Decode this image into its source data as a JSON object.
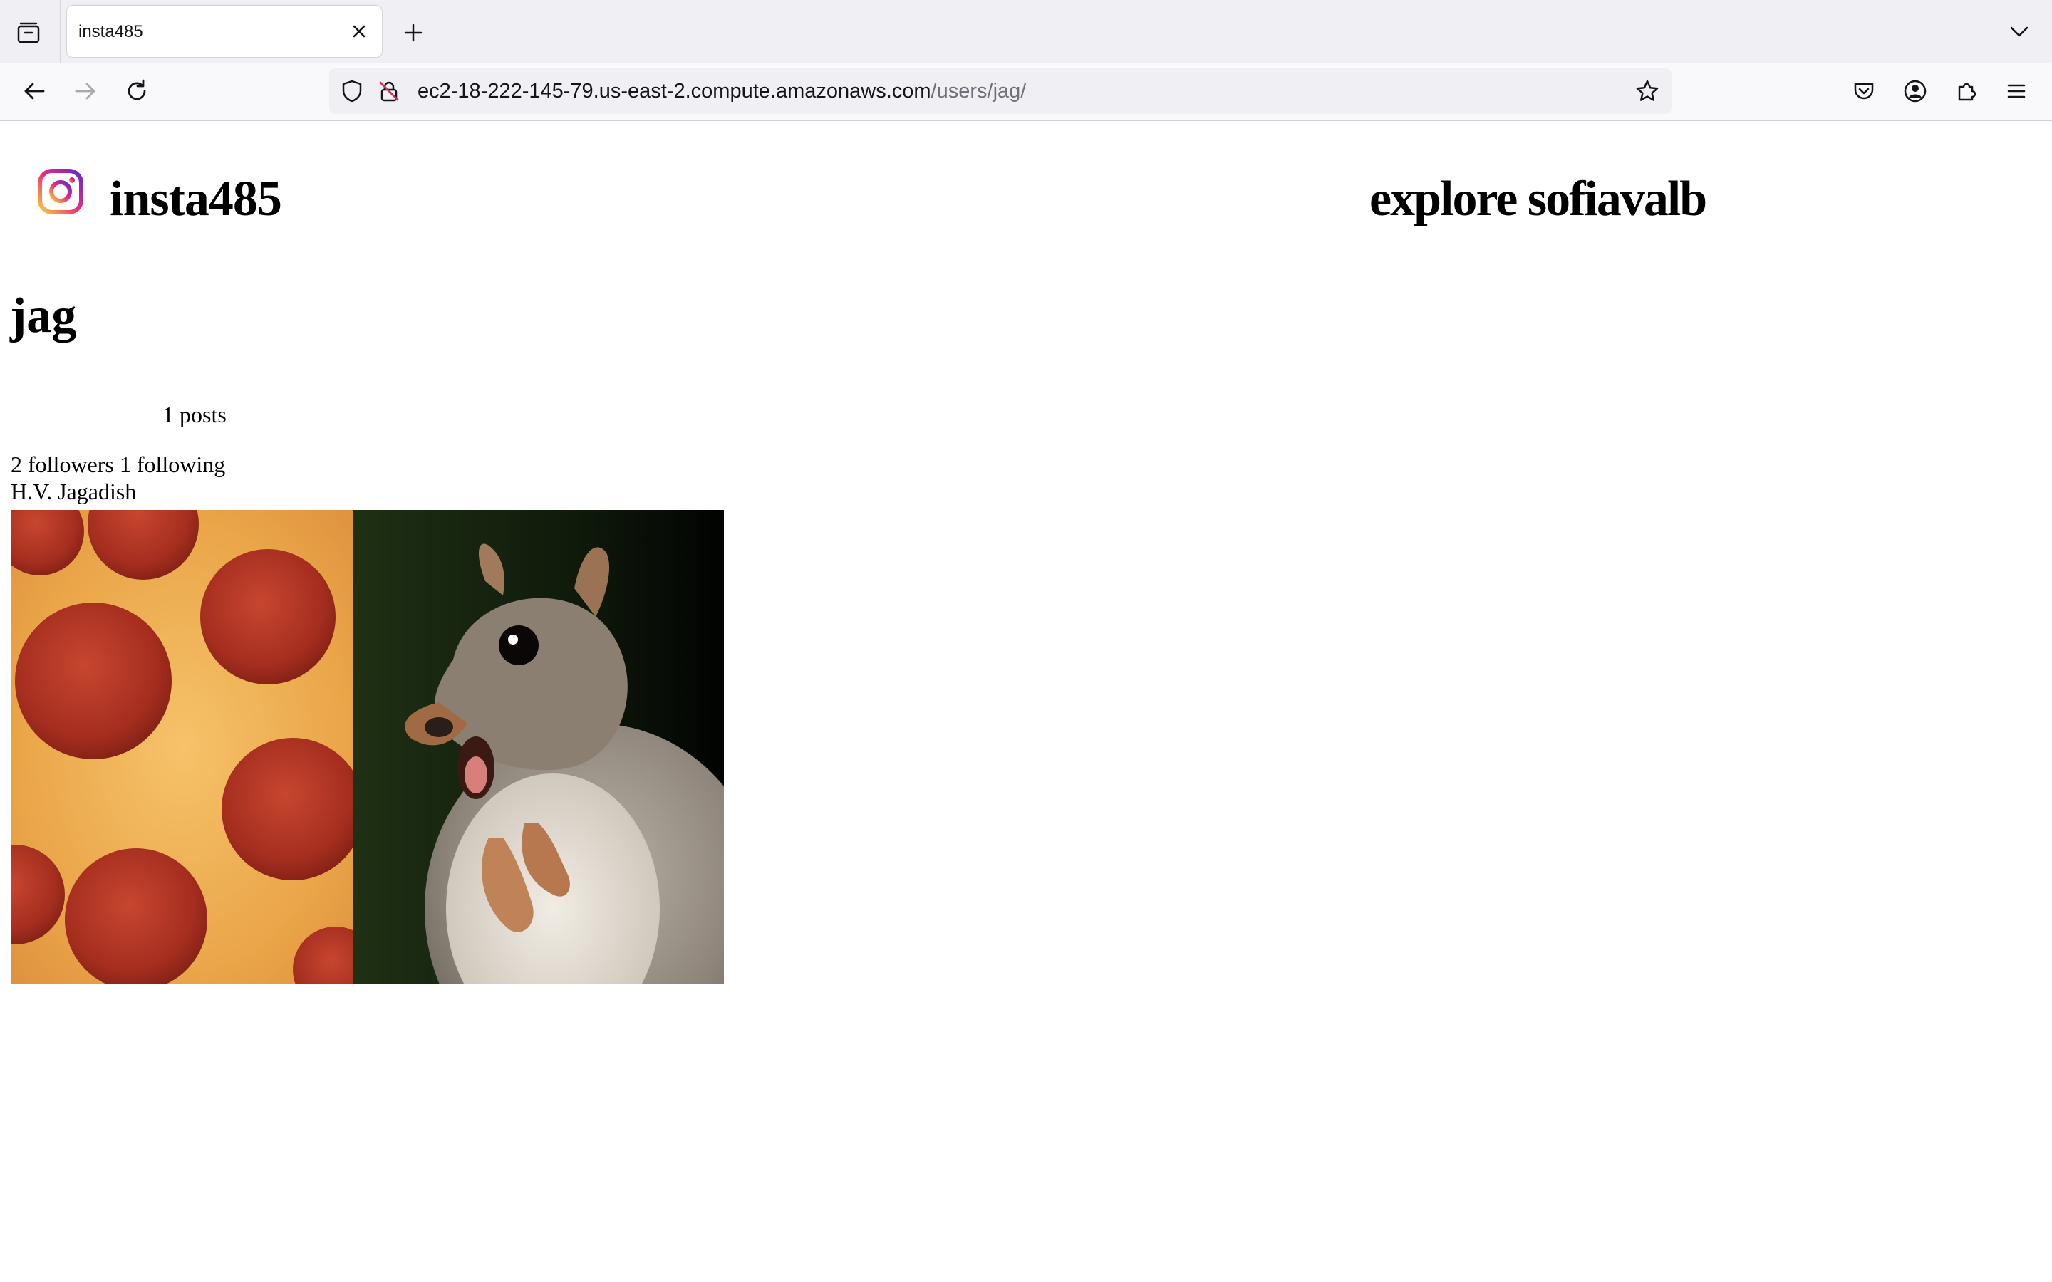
{
  "browser": {
    "tab_title": "insta485",
    "url_host": "ec2-18-222-145-79.us-east-2.compute.amazonaws.com",
    "url_path": "/users/jag/"
  },
  "header": {
    "brand": "insta485",
    "explore_link": "explore",
    "user_link": "sofiavalb"
  },
  "profile": {
    "username": "jag",
    "posts": "1 posts",
    "followers": "2 followers",
    "following": "1 following",
    "full_name": "H.V. Jagadish"
  },
  "colors": {
    "logo_gradient_start": "#f9ce34",
    "logo_gradient_mid": "#ee2a7b",
    "logo_gradient_end": "#6228d7"
  },
  "icons": {
    "tab_list": "tab-list-icon",
    "close": "close-icon",
    "new_tab": "plus-icon",
    "overflow": "chevron-down-icon",
    "back": "back-arrow-icon",
    "forward": "forward-arrow-icon",
    "reload": "reload-icon",
    "shield": "shield-icon",
    "insecure": "insecure-lock-icon",
    "bookmark": "star-icon",
    "pocket": "pocket-icon",
    "account": "account-icon",
    "extensions": "puzzle-icon",
    "menu": "hamburger-menu-icon"
  }
}
